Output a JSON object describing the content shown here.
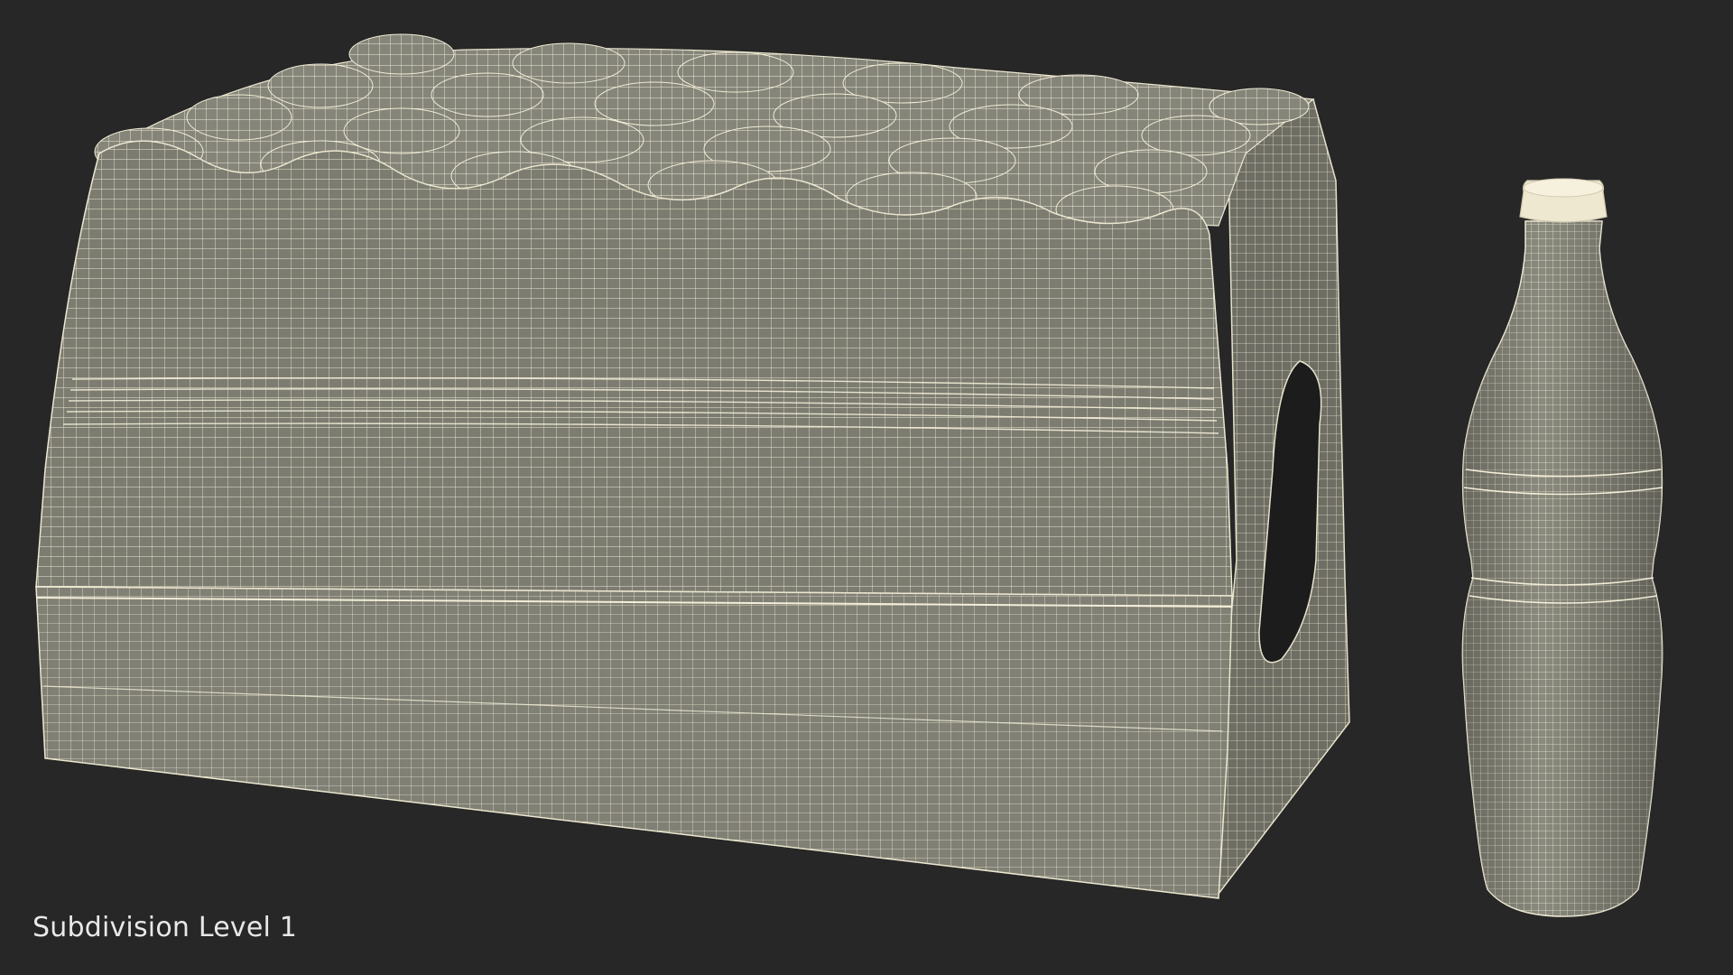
{
  "caption": "Subdivision Level 1",
  "colors": {
    "background": "#272727",
    "mesh_fill": "#7d7d72",
    "mesh_fill_dark": "#63635a",
    "wire": "#f3eed8",
    "cap_fill": "#efe8d0"
  },
  "objects": [
    "wrapped-bottle-pack",
    "single-glass-bottle"
  ]
}
